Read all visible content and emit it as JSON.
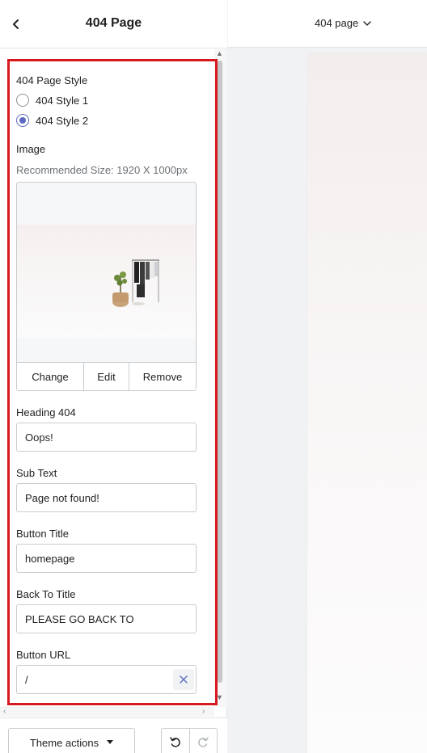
{
  "header": {
    "title": "404 Page",
    "back_icon": "chevron-left-icon"
  },
  "settings": {
    "style": {
      "label": "404 Page Style",
      "options": [
        "404 Style 1",
        "404 Style 2"
      ],
      "selected": "404 Style 2"
    },
    "image": {
      "label": "Image",
      "help": "Recommended Size: 1920 X 1000px",
      "actions": {
        "change": "Change",
        "edit": "Edit",
        "remove": "Remove"
      }
    },
    "heading": {
      "label": "Heading 404",
      "value": "Oops!"
    },
    "subtext": {
      "label": "Sub Text",
      "value": "Page not found!"
    },
    "button_title": {
      "label": "Button Title",
      "value": "homepage"
    },
    "back_to_title": {
      "label": "Back To Title",
      "value": "PLEASE GO BACK TO"
    },
    "button_url": {
      "label": "Button URL",
      "value": "/"
    }
  },
  "footer": {
    "theme_actions": "Theme actions"
  },
  "preview": {
    "page_selector": "404 page"
  },
  "colors": {
    "highlight_border": "#d71920",
    "radio_selected": "#5c6ac4"
  }
}
